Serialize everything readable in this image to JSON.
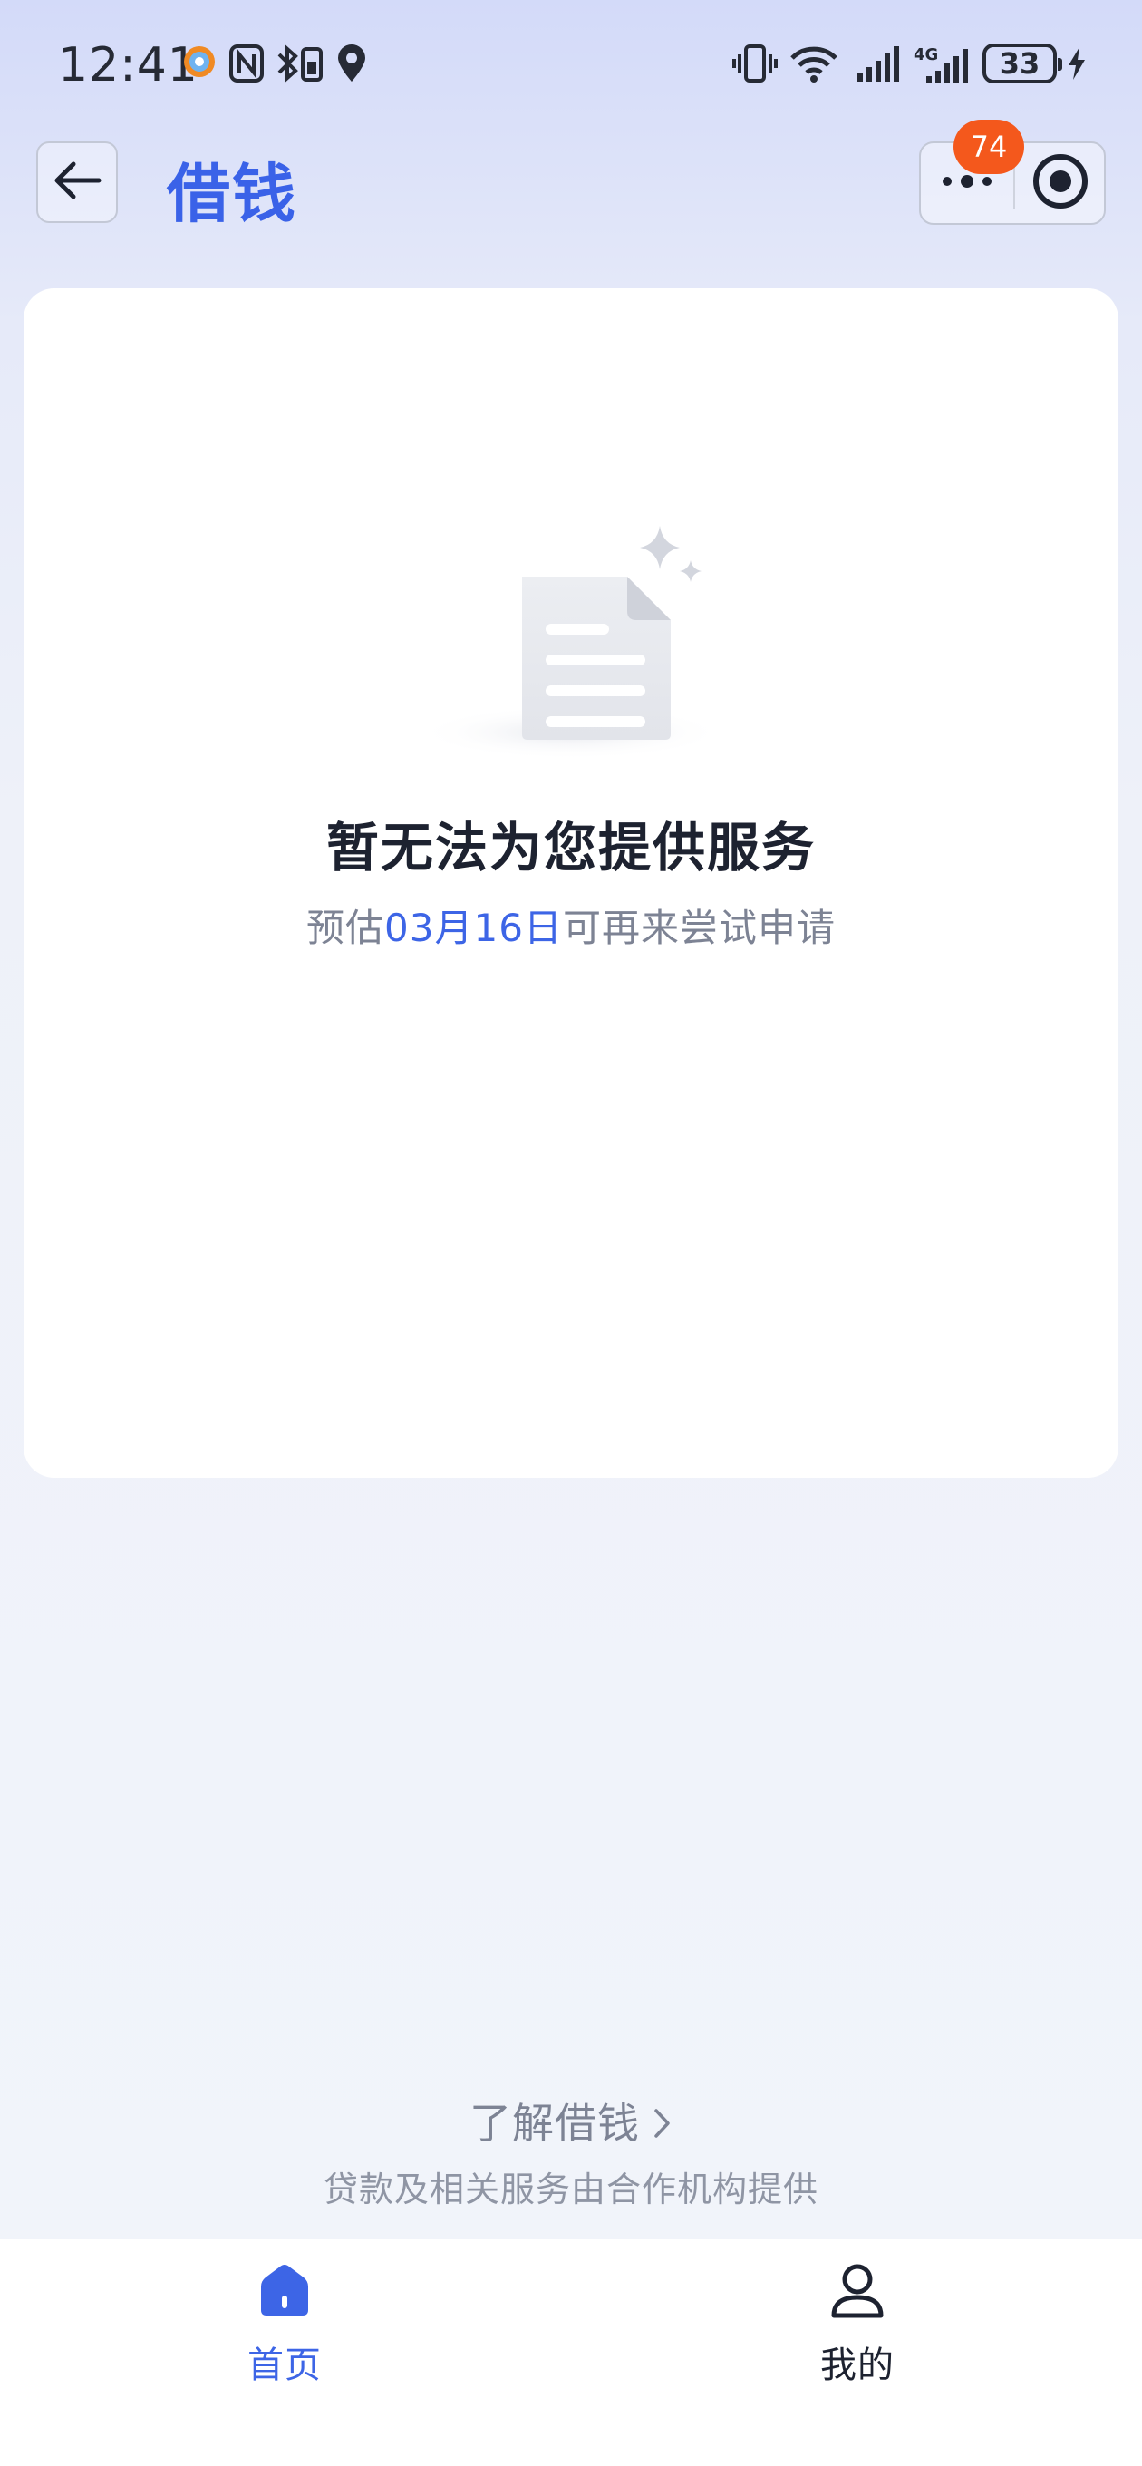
{
  "status_bar": {
    "time": "12:41",
    "battery": "33",
    "network": "4G",
    "icons": [
      "app-notification-icon",
      "nfc-icon",
      "bluetooth-icon",
      "location-icon",
      "vibrate-icon",
      "wifi-icon",
      "signal-icon",
      "signal-4g-icon",
      "battery-icon",
      "charging-icon"
    ]
  },
  "header": {
    "title": "借钱",
    "notification_count": "74"
  },
  "main": {
    "title": "暂无法为您提供服务",
    "subtitle_prefix": "预估",
    "subtitle_date": "03月16日",
    "subtitle_suffix": "可再来尝试申请"
  },
  "footer": {
    "learn_more": "了解借钱",
    "provider_note": "贷款及相关服务由合作机构提供"
  },
  "tabs": [
    {
      "label": "首页",
      "icon": "home-icon",
      "active": true
    },
    {
      "label": "我的",
      "icon": "user-icon",
      "active": false
    }
  ],
  "colors": {
    "accent": "#3d65e6",
    "badge": "#f4581c",
    "title_text": "#1d2230",
    "secondary_text": "#7d8394"
  }
}
